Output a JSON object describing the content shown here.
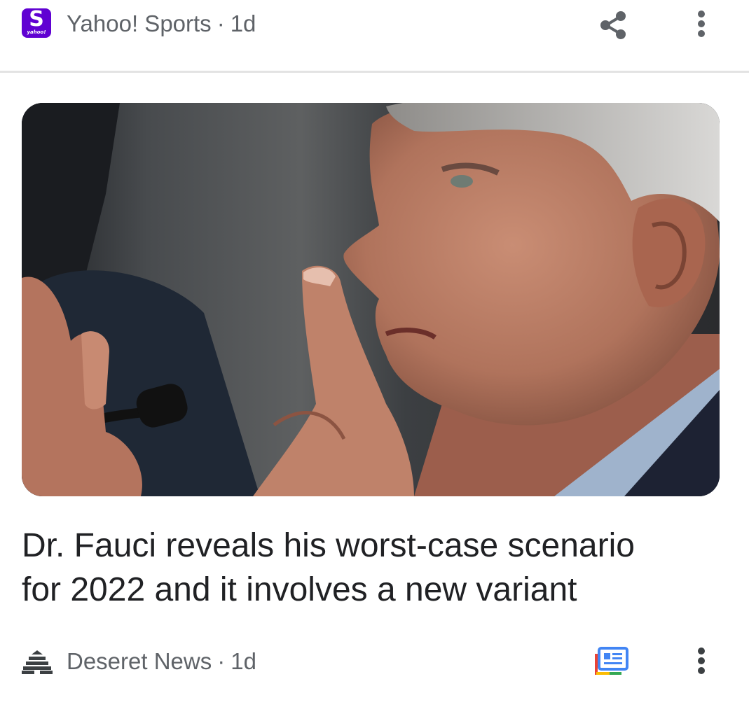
{
  "source": {
    "logo_letter": "S",
    "logo_subtext": "yahoo!",
    "name": "Yahoo! Sports",
    "separator": "·",
    "age": "1d"
  },
  "icons": {
    "share": "share-icon",
    "more": "more-vert-icon",
    "publisher": "beehive-icon",
    "full_coverage": "full-coverage-icon"
  },
  "article": {
    "headline_line1": "Dr. Fauci reveals his worst-case scenario",
    "headline_line2": "for 2022 and it involves a new variant"
  },
  "publisher": {
    "name": "Deseret News",
    "separator": "·",
    "age": "1d"
  },
  "colors": {
    "yahoo_purple": "#6001d2",
    "meta_text": "#5f6368",
    "headline_text": "#202124",
    "divider": "#e3e3e3"
  }
}
